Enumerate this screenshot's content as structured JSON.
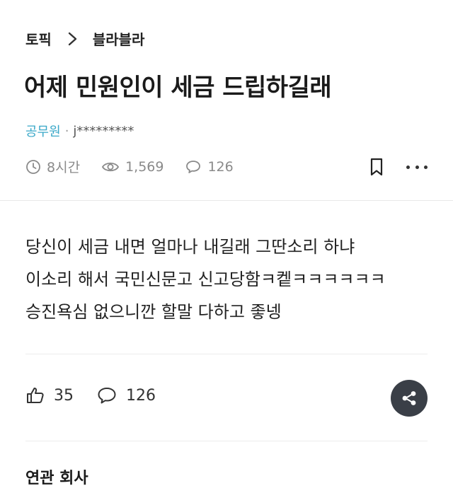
{
  "breadcrumb": {
    "root": "토픽",
    "current": "블라블라"
  },
  "post": {
    "title": "어제 민원인이 세금 드립하길래",
    "company": "공무원",
    "separator": "·",
    "username": "j*********",
    "time": "8시간",
    "views": "1,569",
    "comments": "126",
    "body": [
      "당신이 세금 내면 얼마나 내길래 그딴소리 하냐",
      "이소리 해서 국민신문고 신고당함ㅋ켙ㅋㅋㅋㅋㅋㅋ",
      "승진욕심 없으니깐 할말 다하고 좋넹"
    ]
  },
  "reactions": {
    "likes": "35",
    "comments": "126"
  },
  "related": {
    "heading": "연관 회사"
  },
  "icons": {
    "clock": "clock-icon",
    "eye": "eye-icon",
    "comment": "comment-icon",
    "bookmark": "bookmark-icon",
    "more": "more-icon",
    "like": "thumbs-up-icon",
    "share": "share-icon"
  },
  "colors": {
    "company": "#3aa8c8",
    "share_bg": "#3a3f47"
  }
}
